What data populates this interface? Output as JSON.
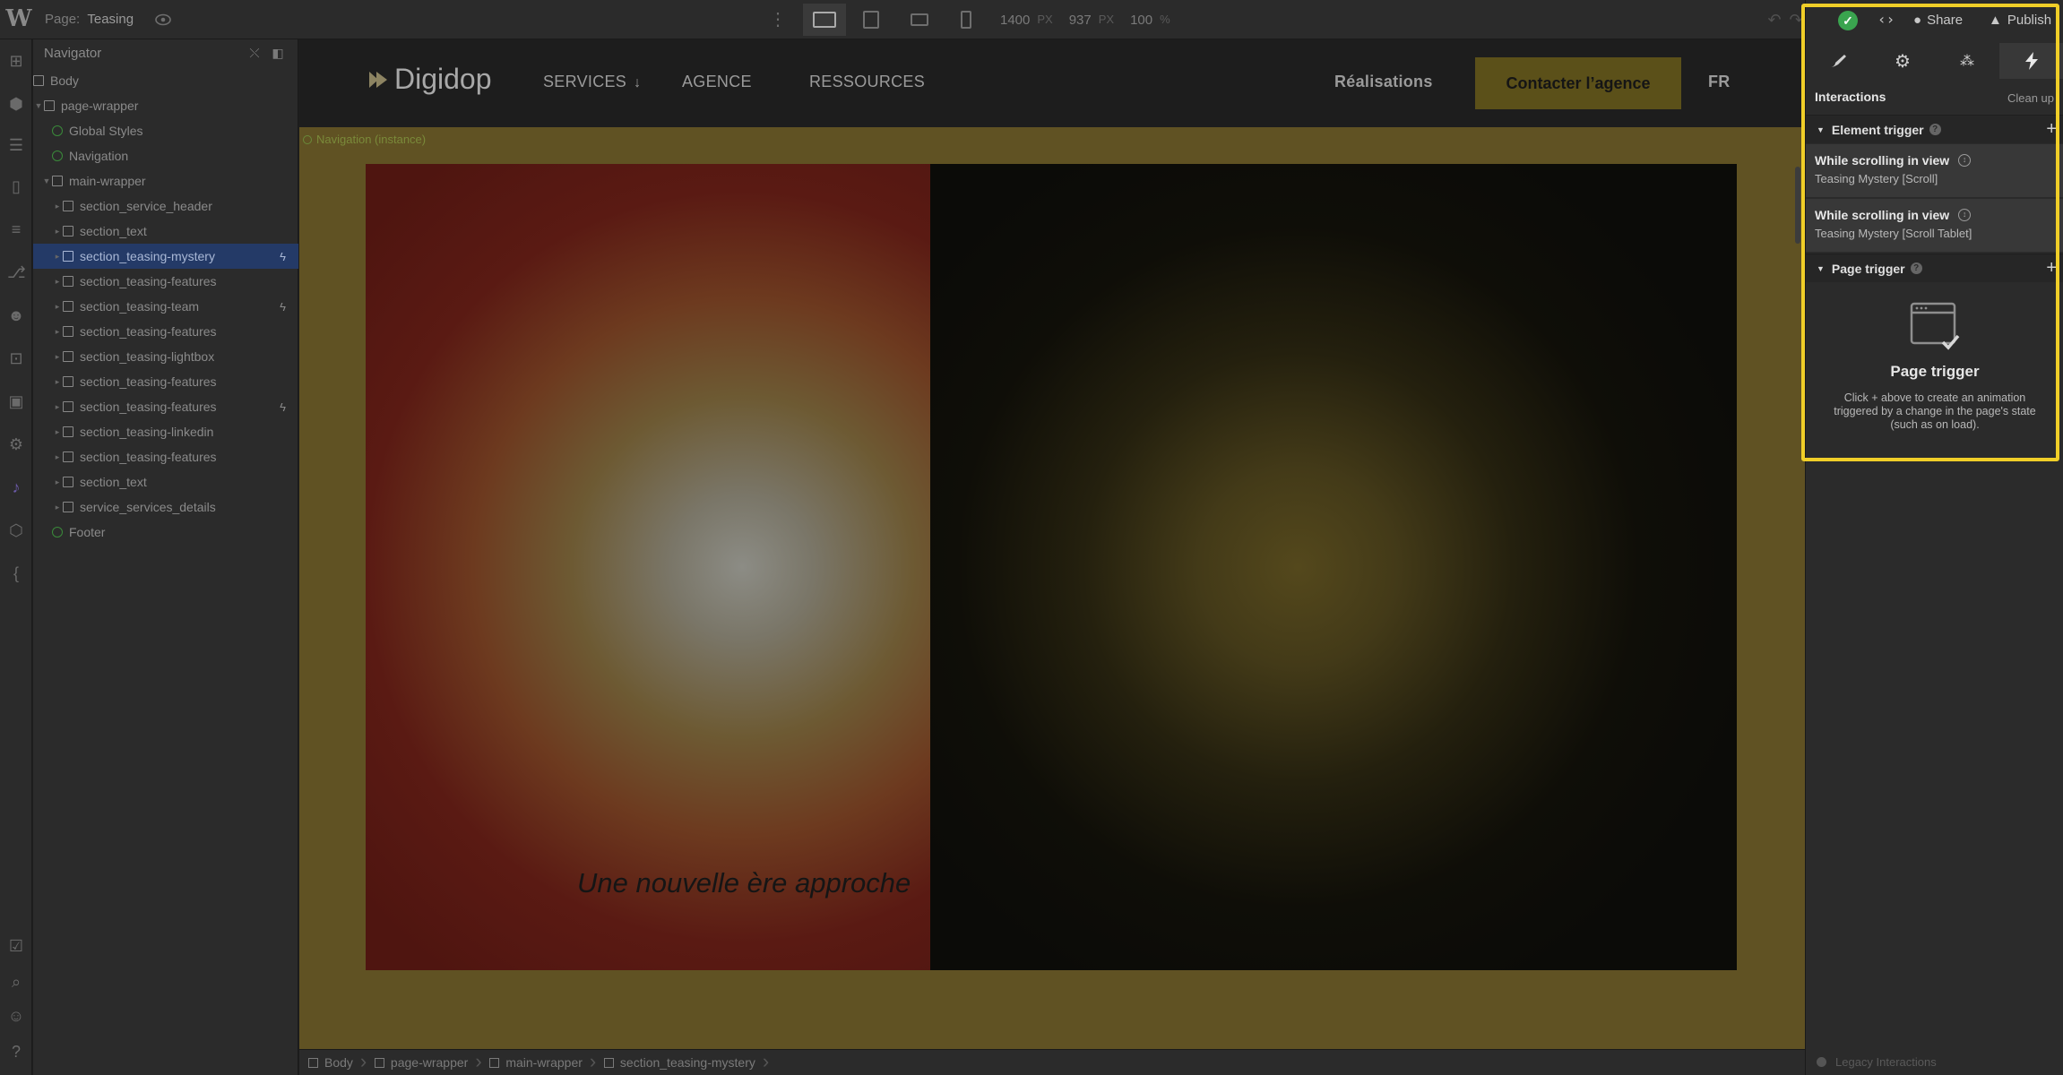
{
  "topbar": {
    "page_prefix": "Page:",
    "page_name": "Teasing",
    "width_value": "1400",
    "width_unit": "PX",
    "height_value": "937",
    "height_unit": "PX",
    "zoom_value": "100",
    "zoom_unit": "%"
  },
  "navigator": {
    "title": "Navigator",
    "items": [
      {
        "label": "Body"
      },
      {
        "label": "page-wrapper"
      },
      {
        "label": "Global Styles"
      },
      {
        "label": "Navigation"
      },
      {
        "label": "main-wrapper"
      },
      {
        "label": "section_service_header"
      },
      {
        "label": "section_text"
      },
      {
        "label": "section_teasing-mystery"
      },
      {
        "label": "section_teasing-features"
      },
      {
        "label": "section_teasing-team"
      },
      {
        "label": "section_teasing-features"
      },
      {
        "label": "section_teasing-lightbox"
      },
      {
        "label": "section_teasing-features"
      },
      {
        "label": "section_teasing-features"
      },
      {
        "label": "section_teasing-linkedin"
      },
      {
        "label": "section_teasing-features"
      },
      {
        "label": "section_text"
      },
      {
        "label": "service_services_details"
      },
      {
        "label": "Footer"
      }
    ]
  },
  "site": {
    "brand": "Digidop",
    "links": {
      "services": "SERVICES",
      "agence": "AGENCE",
      "ressources": "RESSOURCES",
      "realisations": "Réalisations",
      "lang": "FR"
    },
    "cta": "Contacter l’agence",
    "nav_instance": "Navigation (instance)",
    "hero_text": "Une nouvelle ère approche"
  },
  "breadcrumb": [
    "Body",
    "page-wrapper",
    "main-wrapper",
    "section_teasing-mystery"
  ],
  "right_panel": {
    "share": "Share",
    "publish": "Publish",
    "section_title": "Interactions",
    "clean_up": "Clean up",
    "element_trigger": {
      "title": "Element trigger",
      "items": [
        {
          "title": "While scrolling in view",
          "subtitle": "Teasing Mystery [Scroll]"
        },
        {
          "title": "While scrolling in view",
          "subtitle": "Teasing Mystery [Scroll Tablet]"
        }
      ]
    },
    "page_trigger": {
      "title": "Page trigger",
      "empty_title": "Page trigger",
      "empty_body": "Click + above to create an animation triggered by a change in the page's state (such as on load)."
    },
    "legacy": "Legacy Interactions"
  },
  "colors": {
    "highlight": "#f0ce28",
    "selected_row": "#243a67",
    "cta_bg": "#5b5019",
    "canvas_bg": "#605223",
    "status_ok": "#3aa44f"
  }
}
